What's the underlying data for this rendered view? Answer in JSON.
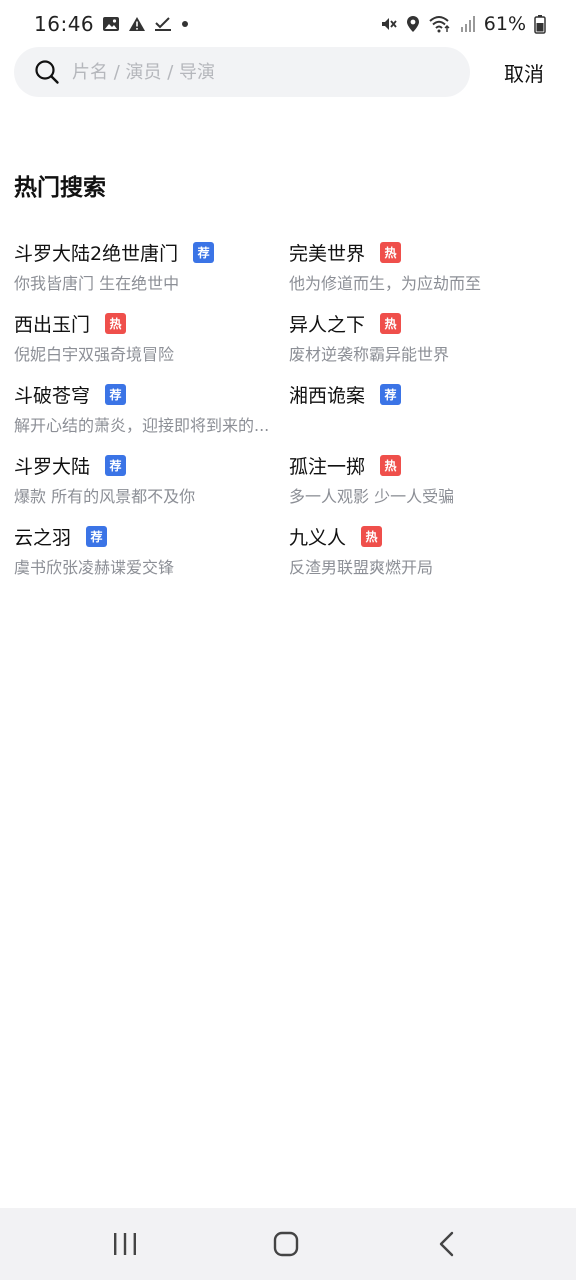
{
  "status_bar": {
    "time": "16:46",
    "left_icons": [
      "image-icon",
      "alert-icon",
      "check-icon",
      "dot-icon"
    ],
    "right_icons": [
      "mute-icon",
      "location-icon",
      "wifi-icon",
      "signal-icon"
    ],
    "battery_percent": "61%"
  },
  "search": {
    "placeholder": "片名 / 演员 / 导演",
    "value": "",
    "cancel_label": "取消"
  },
  "hot": {
    "title": "热门搜索",
    "badge_colors": {
      "荐": "#3b74e6",
      "热": "#ef4f4b"
    },
    "items": [
      {
        "name": "斗罗大陆2绝世唐门",
        "badge": "荐",
        "desc": "你我皆唐门 生在绝世中"
      },
      {
        "name": "完美世界",
        "badge": "热",
        "desc": "他为修道而生，为应劫而至"
      },
      {
        "name": "西出玉门",
        "badge": "热",
        "desc": "倪妮白宇双强奇境冒险"
      },
      {
        "name": "异人之下",
        "badge": "热",
        "desc": "废材逆袭称霸异能世界"
      },
      {
        "name": "斗破苍穹",
        "badge": "荐",
        "desc": "解开心结的萧炎，迎接即将到来的..."
      },
      {
        "name": "湘西诡案",
        "badge": "荐",
        "desc": ""
      },
      {
        "name": "斗罗大陆",
        "badge": "荐",
        "desc": "爆款 所有的风景都不及你"
      },
      {
        "name": "孤注一掷",
        "badge": "热",
        "desc": "多一人观影 少一人受骗"
      },
      {
        "name": "云之羽",
        "badge": "荐",
        "desc": "虞书欣张凌赫谍爱交锋"
      },
      {
        "name": "九义人",
        "badge": "热",
        "desc": "反渣男联盟爽燃开局"
      }
    ]
  },
  "nav_bar": {
    "buttons": [
      "recent-apps-icon",
      "home-icon",
      "back-icon"
    ]
  }
}
